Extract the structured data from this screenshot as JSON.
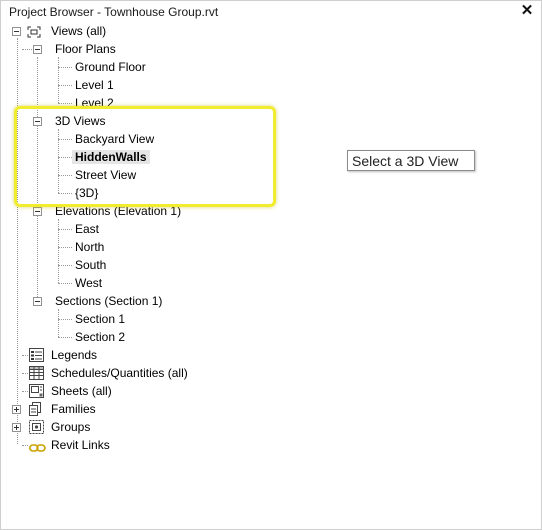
{
  "window": {
    "title": "Project Browser - Townhouse Group.rvt",
    "close_label": "✕"
  },
  "tree": {
    "views": "Views (all)",
    "floor_plans": {
      "label": "Floor Plans",
      "items": [
        "Ground Floor",
        "Level 1",
        "Level 2"
      ]
    },
    "views_3d": {
      "label": "3D Views",
      "items": [
        "Backyard View",
        "HiddenWalls",
        "Street View",
        "{3D}"
      ],
      "selected": "HiddenWalls"
    },
    "elevations": {
      "label": "Elevations (Elevation 1)",
      "items": [
        "East",
        "North",
        "South",
        "West"
      ]
    },
    "sections": {
      "label": "Sections (Section 1)",
      "items": [
        "Section 1",
        "Section 2"
      ]
    },
    "legends": "Legends",
    "schedules": "Schedules/Quantities (all)",
    "sheets": "Sheets (all)",
    "families": "Families",
    "groups": "Groups",
    "revit_links": "Revit Links"
  },
  "callout": {
    "text": "Select a 3D View",
    "highlight_color": "#f2ec2e"
  }
}
